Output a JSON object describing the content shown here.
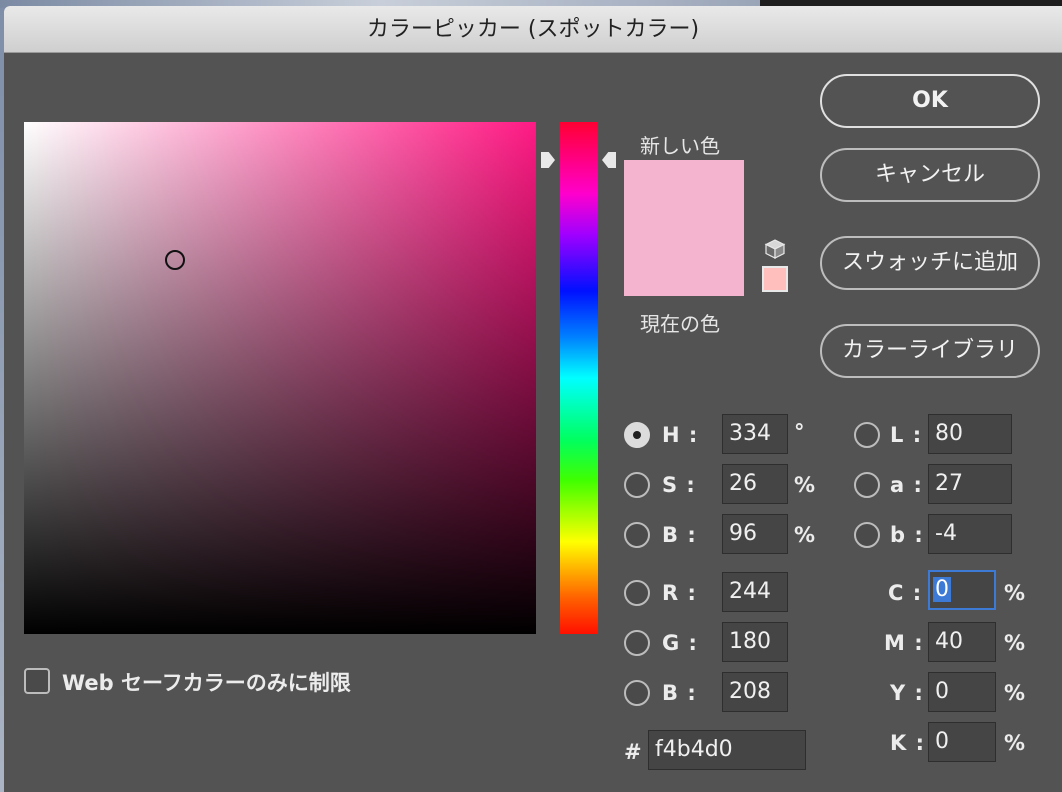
{
  "window": {
    "title": "カラーピッカー (スポットカラー)"
  },
  "swatches": {
    "new_label": "新しい色",
    "current_label": "現在の色",
    "new_color": "#f4b4d0",
    "alt_color": "#ffbfbd"
  },
  "buttons": {
    "ok": "OK",
    "cancel": "キャンセル",
    "add_swatch": "スウォッチに追加",
    "color_library": "カラーライブラリ"
  },
  "hsb": {
    "h_label": "H :",
    "h_value": "334",
    "h_unit": "°",
    "s_label": "S :",
    "s_value": "26",
    "s_unit": "%",
    "b_label": "B :",
    "b_value": "96",
    "b_unit": "%",
    "selected": "H"
  },
  "rgb": {
    "r_label": "R :",
    "r_value": "244",
    "g_label": "G :",
    "g_value": "180",
    "b_label": "B :",
    "b_value": "208"
  },
  "lab": {
    "l_label": "L :",
    "l_value": "80",
    "a_label": "a :",
    "a_value": "27",
    "b_label": "b :",
    "b_value": "-4"
  },
  "cmyk": {
    "c_label": "C :",
    "c_value": "0",
    "c_unit": "%",
    "m_label": "M :",
    "m_value": "40",
    "m_unit": "%",
    "y_label": "Y :",
    "y_value": "0",
    "y_unit": "%",
    "k_label": "K :",
    "k_value": "0",
    "k_unit": "%"
  },
  "hex": {
    "label": "#",
    "value": "f4b4d0"
  },
  "web_safe": {
    "label": "Web セーフカラーのみに制限",
    "checked": false
  },
  "icons": {
    "gamut": "cube-icon"
  }
}
